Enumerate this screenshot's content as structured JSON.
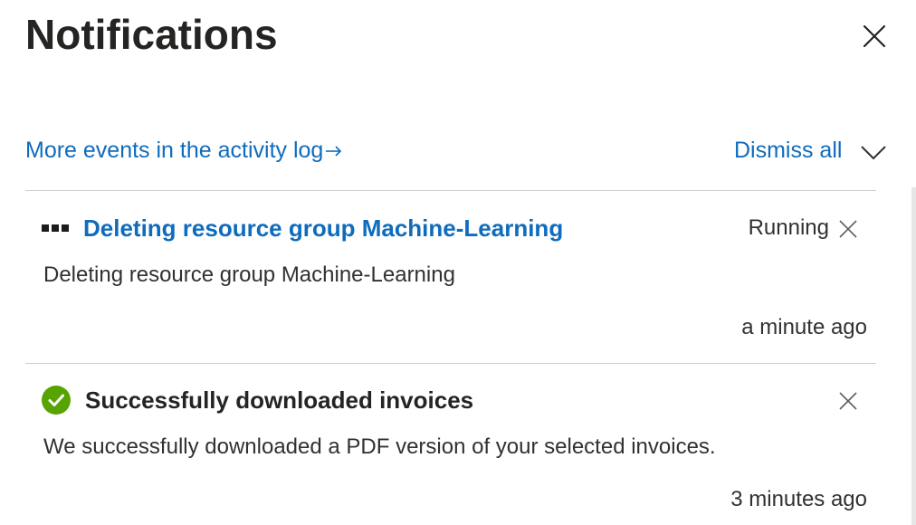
{
  "header": {
    "title": "Notifications",
    "close_icon": "close-icon"
  },
  "toolbar": {
    "activity_link": "More events in the activity log",
    "activity_arrow_icon": "arrow-right-icon",
    "dismiss_all": "Dismiss all",
    "collapse_icon": "chevron-down-icon"
  },
  "notifications": [
    {
      "icon": "progress-dots-icon",
      "title": "Deleting resource group Machine-Learning",
      "status": "Running",
      "body": "Deleting resource group Machine-Learning",
      "time": "a minute ago"
    },
    {
      "icon": "success-check-icon",
      "title": "Successfully downloaded invoices",
      "status": "",
      "body": "We successfully downloaded a PDF version of your selected invoices.",
      "time": "3 minutes ago"
    }
  ],
  "colors": {
    "link": "#0f6cbd",
    "success": "#57a300",
    "text": "#323130",
    "divider": "#cfcfcf"
  }
}
